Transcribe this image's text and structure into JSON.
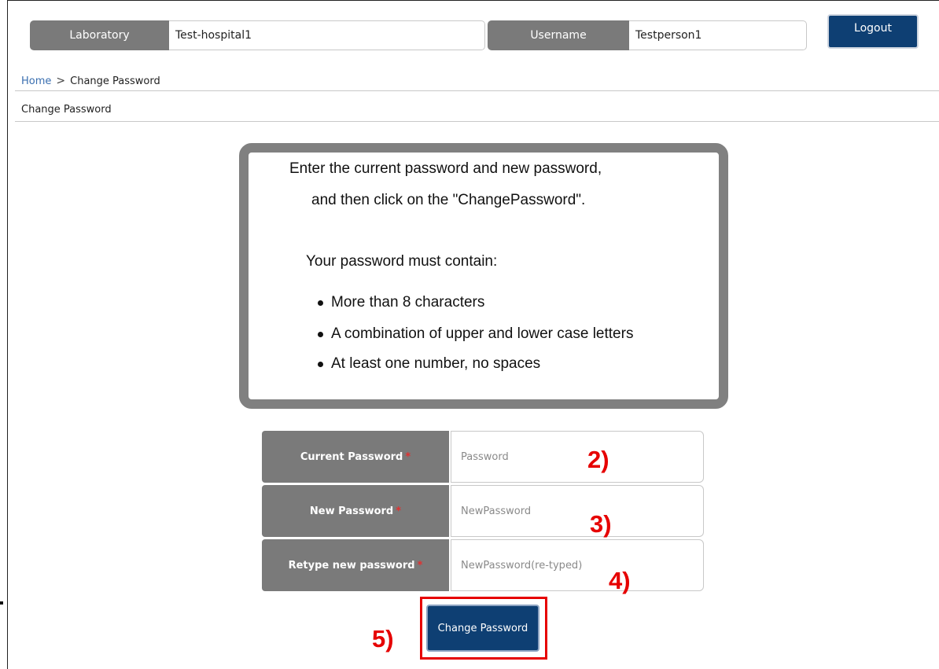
{
  "header": {
    "laboratory_label": "Laboratory",
    "laboratory_value": "Test-hospital1",
    "username_label": "Username",
    "username_value": "Testperson1",
    "logout_label": "Logout"
  },
  "breadcrumb": {
    "home": "Home",
    "separator": ">",
    "current": "Change Password"
  },
  "section_title": "Change Password",
  "instructions": {
    "line1": "Enter the current password and new password,",
    "line2": "and then click on the \"ChangePassword\".",
    "line3": "Your password must contain:",
    "rules": [
      "More than 8 characters",
      "A combination of upper and lower case letters",
      "At least one number, no spaces"
    ]
  },
  "form": {
    "current_password": {
      "label": "Current Password",
      "required": "*",
      "placeholder": "Password"
    },
    "new_password": {
      "label": "New Password",
      "required": "*",
      "placeholder": "NewPassword"
    },
    "retype_password": {
      "label": "Retype new password",
      "required": "*",
      "placeholder": "NewPassword(re-typed)"
    },
    "submit_label": "Change Password"
  },
  "annotations": {
    "step2": "2)",
    "step3": "3)",
    "step4": "4)",
    "step5": "5)"
  },
  "colors": {
    "accent_navy": "#0e3f73",
    "label_gray": "#7a7a7a",
    "annotation_red": "#e60000",
    "required_red": "#e23030"
  }
}
